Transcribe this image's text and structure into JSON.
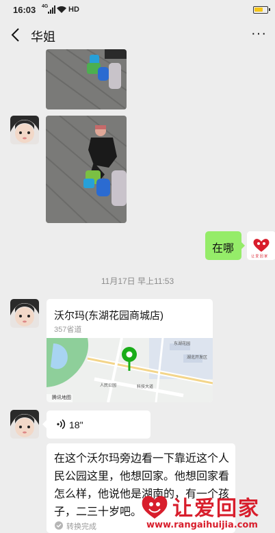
{
  "status_bar": {
    "time": "16:03",
    "network": "4G",
    "hd": "HD"
  },
  "nav": {
    "title": "华姐",
    "more": "···"
  },
  "self_avatar": {
    "org_label": "让 爱 回 家"
  },
  "messages": {
    "reply_text": "在哪",
    "timestamp": "11月17日 早上11:53",
    "location": {
      "name": "沃尔玛(东湖花园商城店)",
      "address": "357省道",
      "map_provider": "腾讯地图",
      "map_labels": [
        "东湖花园",
        "人民公园",
        "科技大道",
        "湖北开发区"
      ]
    },
    "voice": {
      "duration": "18\""
    },
    "transcript": {
      "text": "在这个沃尔玛旁边看一下靠近这个人民公园这里，他想回家。他想回家看怎么样，他说他是湖南的，有一个孩子，二三十岁吧。",
      "status": "转换完成"
    }
  },
  "watermark": {
    "title": "让爱回家",
    "url": "www.rangaihuijia.com"
  },
  "colors": {
    "self_bubble": "#95ec69",
    "background": "#ededed",
    "brand_red": "#d81e2c"
  }
}
